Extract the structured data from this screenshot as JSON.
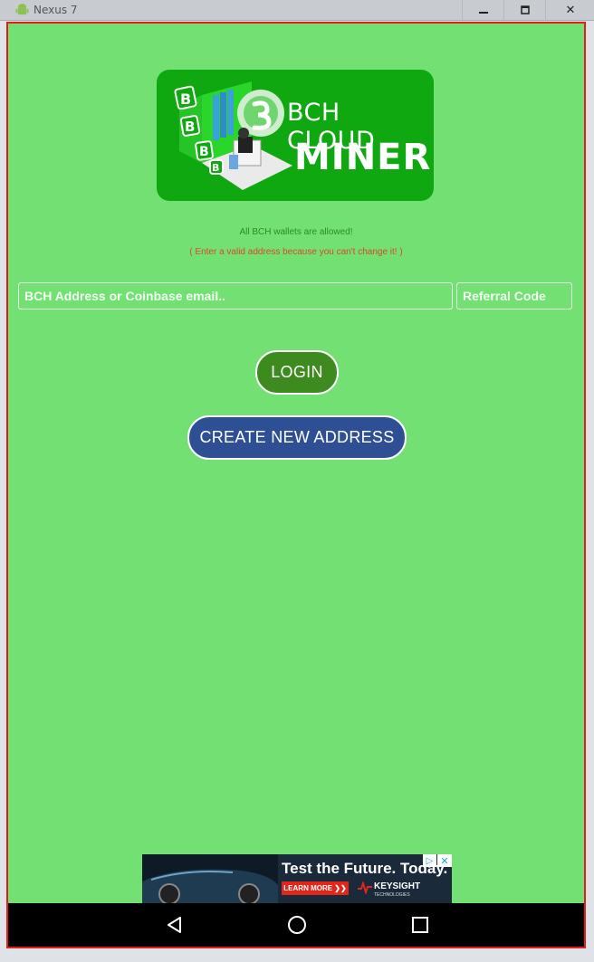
{
  "window": {
    "title": "Nexus 7",
    "minimize_label": "🗕",
    "maximize_label": "🗖",
    "close_label": "✕"
  },
  "logo": {
    "line1": "BCH CLOUD",
    "line2": "MINER"
  },
  "notes": {
    "allowed": "All BCH wallets are allowed!",
    "warning": "( Enter a valid address because you can't change it! )"
  },
  "form": {
    "address_placeholder": "BCH Address or Coinbase email..",
    "address_value": "",
    "referral_placeholder": "Referral Code",
    "referral_value": ""
  },
  "buttons": {
    "login": "LOGIN",
    "create": "CREATE NEW ADDRESS"
  },
  "ad": {
    "headline": "Test the Future. Today.",
    "cta": "LEARN MORE ❯❯",
    "brand": "KEYSIGHT",
    "brand_sub": "TECHNOLOGIES",
    "adchoices_icon": "adchoices-icon",
    "close_icon": "close-icon"
  },
  "colors": {
    "screen_bg": "#73e073",
    "logo_bg": "#10a810",
    "login_bg": "#3d8b1f",
    "create_bg": "#2e4f94",
    "note_green": "#2c8a2c",
    "note_red": "#d84a2a",
    "frame_border": "#e21b1b"
  },
  "navbar": {
    "icons": [
      "back-icon",
      "home-icon",
      "recents-icon"
    ]
  }
}
